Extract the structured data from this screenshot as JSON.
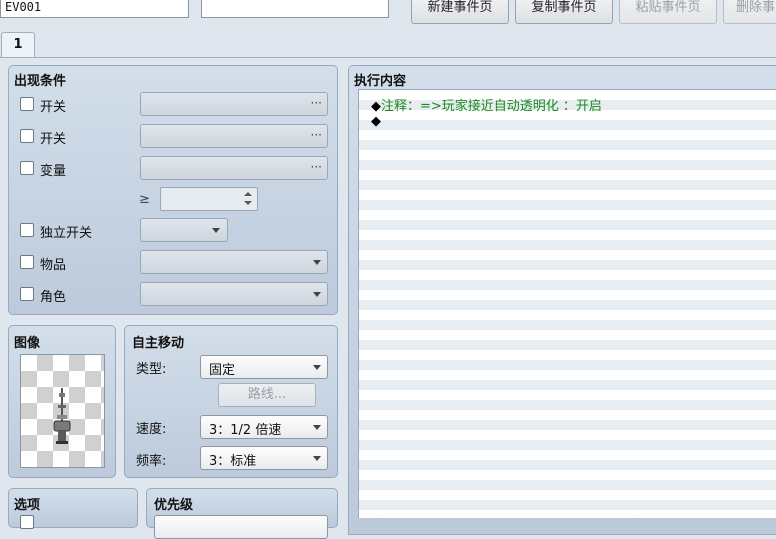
{
  "event_name": "EV001",
  "event_note": "",
  "toolbar": {
    "new_page": "新建事件页",
    "copy_page": "复制事件页",
    "paste_page": "粘贴事件页",
    "delete_page": "删除事"
  },
  "tabs": [
    {
      "label": "1"
    }
  ],
  "conditions": {
    "title": "出现条件",
    "switch1": {
      "label": "开关",
      "value": "",
      "button": "···"
    },
    "switch2": {
      "label": "开关",
      "value": "",
      "button": "···"
    },
    "variable": {
      "label": "变量",
      "value": "",
      "button": "···"
    },
    "ge_symbol": "≥",
    "variable_value": "",
    "self_switch": {
      "label": "独立开关",
      "value": ""
    },
    "item": {
      "label": "物品",
      "value": ""
    },
    "actor": {
      "label": "角色",
      "value": ""
    }
  },
  "image": {
    "title": "图像"
  },
  "autonomous": {
    "title": "自主移动",
    "type_label": "类型:",
    "type_value": "固定",
    "route_button": "路线...",
    "speed_label": "速度:",
    "speed_value": "3：1/2 倍速",
    "freq_label": "频率:",
    "freq_value": "3：标准"
  },
  "options": {
    "title": "选项"
  },
  "priority": {
    "title": "优先级"
  },
  "contents": {
    "title": "执行内容",
    "lines": [
      {
        "marker": "◆",
        "text": "注释：=>玩家接近自动透明化 ：开启"
      },
      {
        "marker": "◆",
        "text": ""
      }
    ]
  }
}
